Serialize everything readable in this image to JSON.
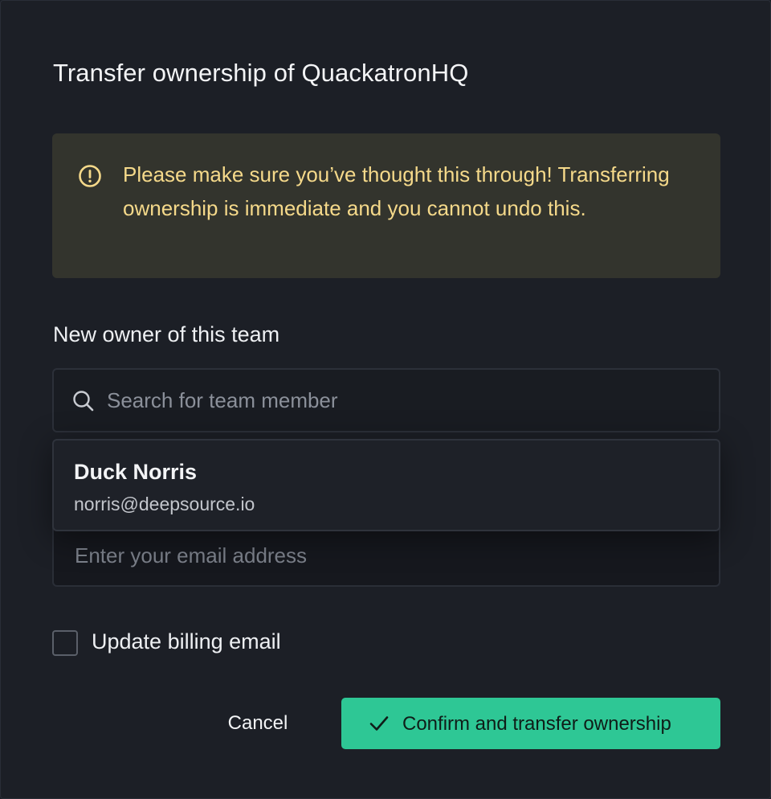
{
  "dialog": {
    "title": "Transfer ownership of QuackatronHQ"
  },
  "alert": {
    "icon": "alert-circle-icon",
    "message": "Please make sure you’ve thought this through! Transferring ownership is immediate and you cannot undo this.",
    "color": "#f5d98a"
  },
  "form": {
    "owner_label": "New owner of this team",
    "search": {
      "icon": "search-icon",
      "placeholder": "Search for team member",
      "value": ""
    },
    "suggestions": [
      {
        "name": "Duck Norris",
        "email": "norris@deepsource.io"
      }
    ],
    "billing_email": {
      "placeholder": "Enter your email address",
      "value": ""
    },
    "update_billing": {
      "label": "Update billing email",
      "checked": false
    }
  },
  "actions": {
    "cancel_label": "Cancel",
    "confirm_label": "Confirm and transfer ownership",
    "confirm_icon": "check-icon",
    "confirm_color": "#2ec795"
  }
}
